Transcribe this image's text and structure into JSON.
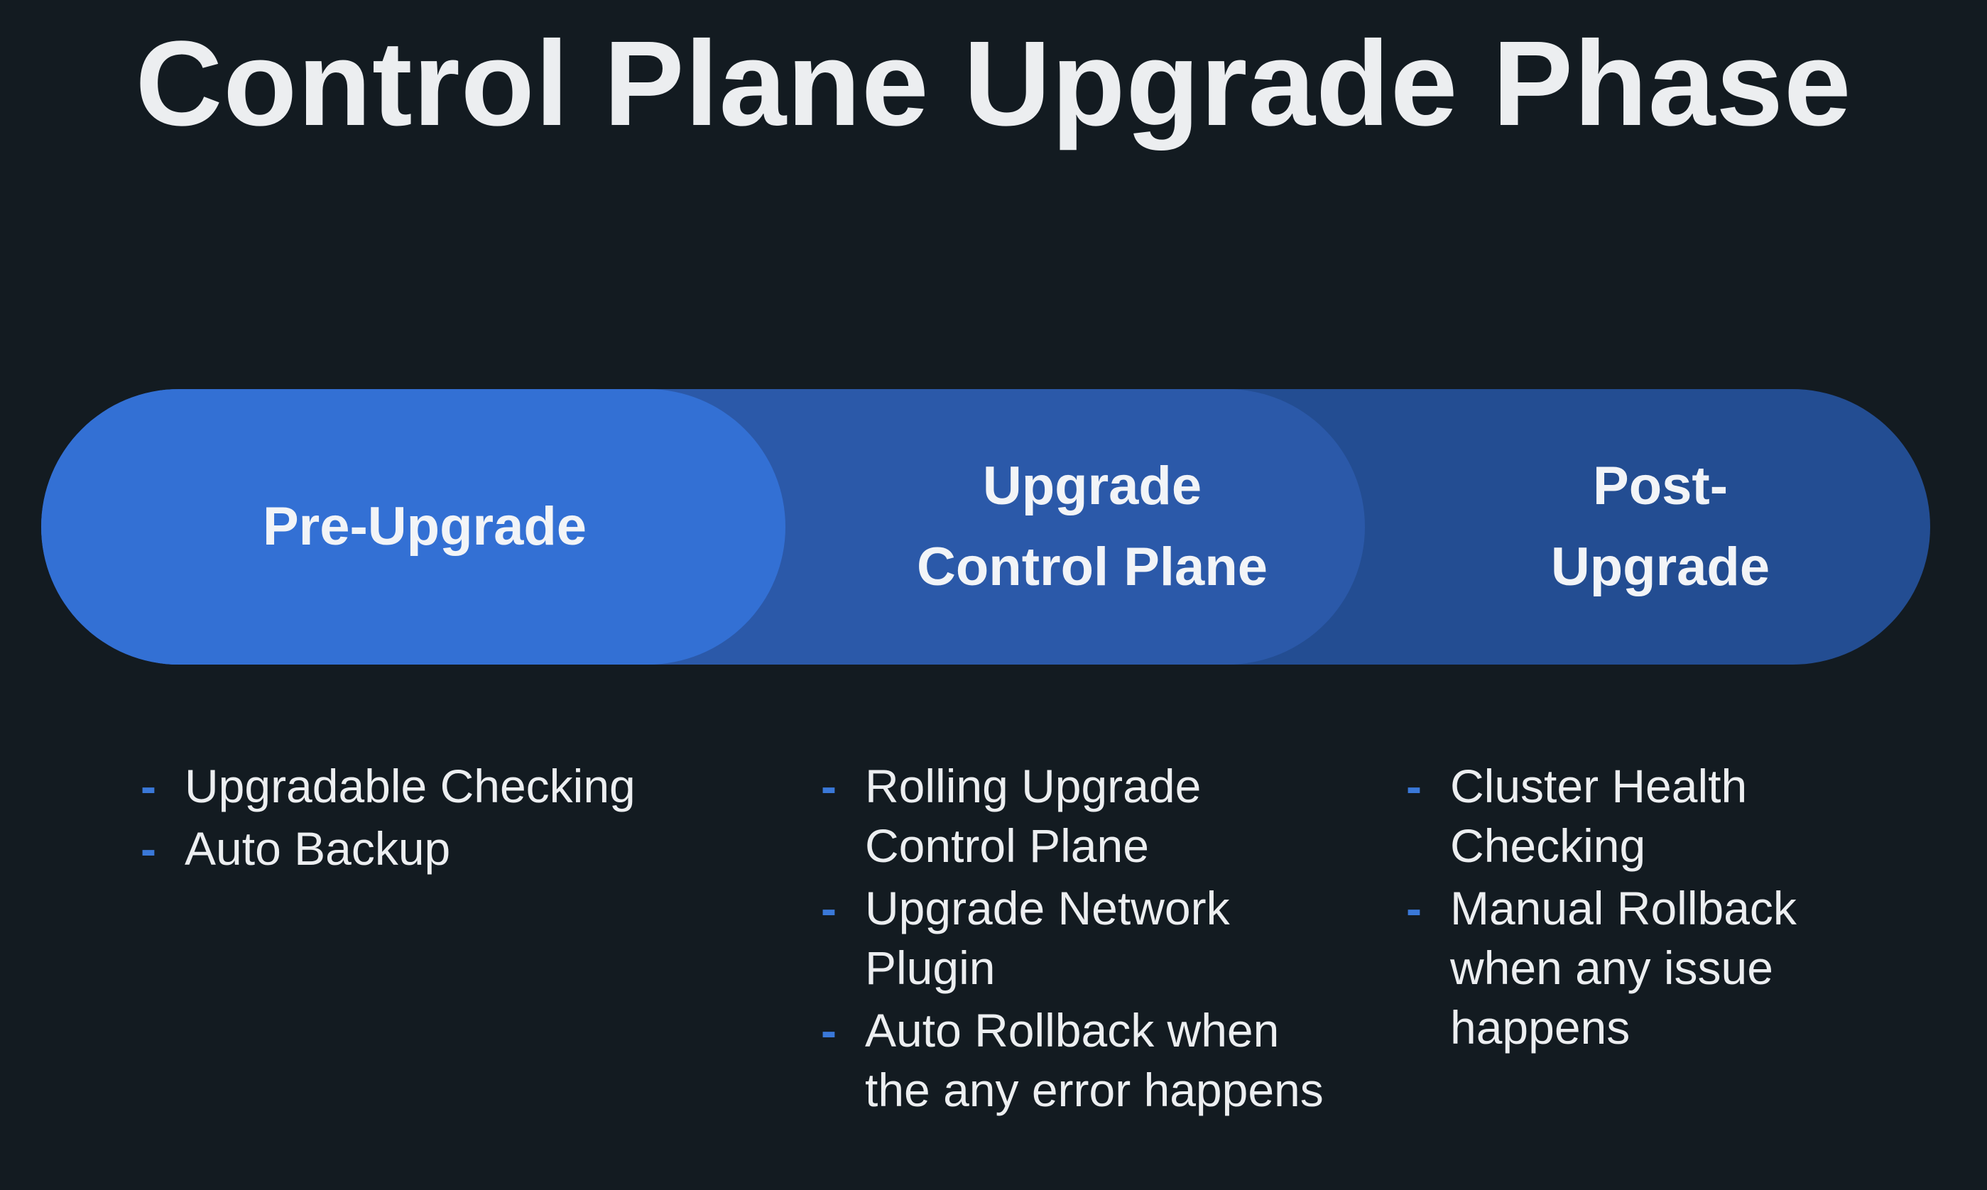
{
  "title": "Control Plane Upgrade Phase",
  "colors": {
    "background": "#131b21",
    "phase_1": "#3370d4",
    "phase_2": "#2b59a9",
    "phase_3": "#234d92",
    "bullet": "#3a78d8",
    "text": "#eceef0"
  },
  "phases": [
    {
      "label": "Pre-Upgrade",
      "items": [
        "Upgradable Checking",
        "Auto Backup"
      ]
    },
    {
      "label": "Upgrade\nControl Plane",
      "items": [
        "Rolling Upgrade Control Plane",
        "Upgrade Network Plugin",
        "Auto Rollback when the any error happens"
      ]
    },
    {
      "label": "Post-\nUpgrade",
      "items": [
        "Cluster Health Checking",
        "Manual Rollback when any issue happens"
      ]
    }
  ],
  "bullet_glyph": "-"
}
